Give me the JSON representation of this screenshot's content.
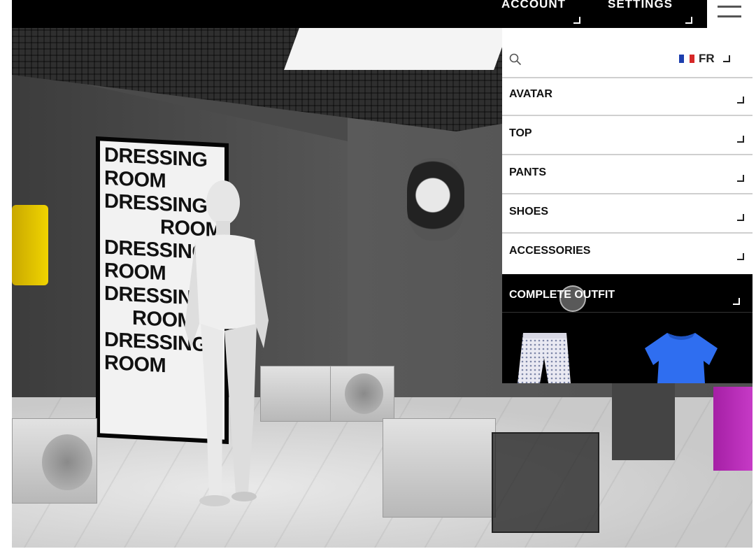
{
  "topbar": {
    "account_label": "ACCOUNT",
    "settings_label": "SETTINGS"
  },
  "panel": {
    "language": "FR",
    "menu": [
      {
        "label": "AVATAR"
      },
      {
        "label": "TOP"
      },
      {
        "label": "PANTS"
      },
      {
        "label": "SHOES"
      },
      {
        "label": "ACCESSORIES"
      }
    ],
    "complete_outfit": "COMPLETE OUTFIT"
  },
  "scene": {
    "poster_lines": [
      "DRESSING",
      "ROOM",
      "DRESSING",
      "ROOM",
      "DRESSING",
      "ROOM",
      "DRESSING",
      "ROOM",
      "DRESSING",
      "ROOM"
    ]
  },
  "colors": {
    "flag_blue": "#1d3fae",
    "flag_white": "#ffffff",
    "flag_red": "#d62828",
    "shirt_blue": "#2f6ef0",
    "accent_pink": "#c63ac6"
  },
  "icons": {
    "search": "search-icon",
    "menu": "hamburger-menu-icon",
    "flag": "french-flag-icon"
  }
}
